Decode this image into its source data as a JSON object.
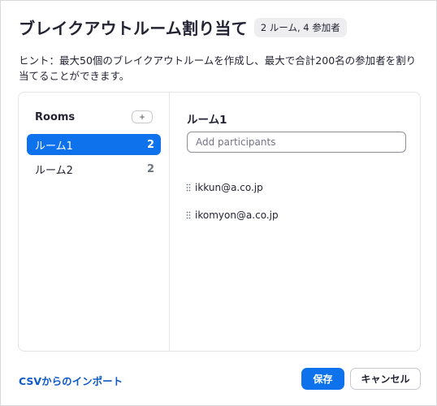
{
  "header": {
    "title": "ブレイクアウトルーム割り当て",
    "summary": "2 ルーム, 4 参加者"
  },
  "hint": "ヒント：最大50個のブレイクアウトルームを作成し、最大で合計200名の参加者を割り当てることができます。",
  "rooms": {
    "title": "Rooms",
    "add_label": "+",
    "items": [
      {
        "label": "ルーム1",
        "count": "2",
        "selected": true
      },
      {
        "label": "ルーム2",
        "count": "2",
        "selected": false
      }
    ]
  },
  "detail": {
    "title": "ルーム1",
    "input_placeholder": "Add participants",
    "input_value": "",
    "participants": [
      {
        "email": "ikkun@a.co.jp"
      },
      {
        "email": "ikomyon@a.co.jp"
      }
    ]
  },
  "footer": {
    "import_label": "CSVからのインポート",
    "save_label": "保存",
    "cancel_label": "キャンセル"
  },
  "colors": {
    "accent": "#0e72ed",
    "link": "#0e5bc4",
    "badge_bg": "#eeeef1"
  },
  "icons": {
    "drag_handle": "drag-handle-icon",
    "add": "plus-icon"
  }
}
